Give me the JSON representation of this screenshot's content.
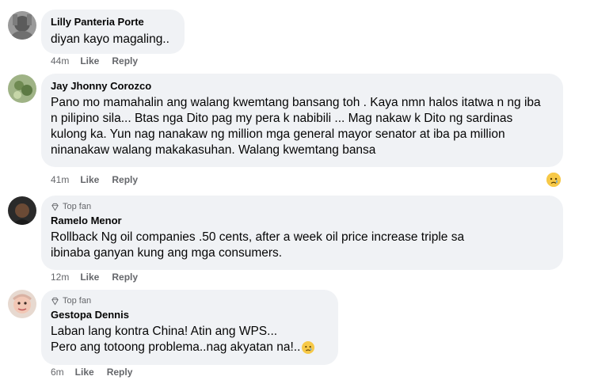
{
  "comments": [
    {
      "author": "Lilly Panteria Porte",
      "text": "diyan kayo magaling..",
      "time": "44m",
      "like": "Like",
      "reply": "Reply"
    },
    {
      "author": "Jay Jhonny Corozco",
      "text": "Pano mo mamahalin ang walang kwemtang bansang toh . Kaya nmn halos itatwa n ng iba n pilipino sila... Btas nga Dito pag my pera k nabibili ... Mag nakaw k Dito ng sardinas kulong ka. Yun nag nanakaw ng million mga general mayor senator at iba pa million ninanakaw walang makakasuhan. Walang kwemtang bansa",
      "time": "41m",
      "like": "Like",
      "reply": "Reply",
      "reaction_icon": "crying-face-icon"
    },
    {
      "badge": "Top fan",
      "author": "Ramelo Menor",
      "text": "Rollback Ng oil companies .50 cents, after a week oil price increase triple sa ibinaba ganyan kung ang mga consumers.",
      "time": "12m",
      "like": "Like",
      "reply": "Reply"
    },
    {
      "badge": "Top fan",
      "author": "Gestopa Dennis",
      "text_line1": "Laban lang kontra China! Atin ang WPS...",
      "text_line2": "Pero ang totoong problema..nag akyatan na!..",
      "time": "6m",
      "like": "Like",
      "reply": "Reply"
    }
  ],
  "colors": {
    "bubble": "#f0f2f5",
    "meta": "#65676b",
    "text": "#050505"
  }
}
